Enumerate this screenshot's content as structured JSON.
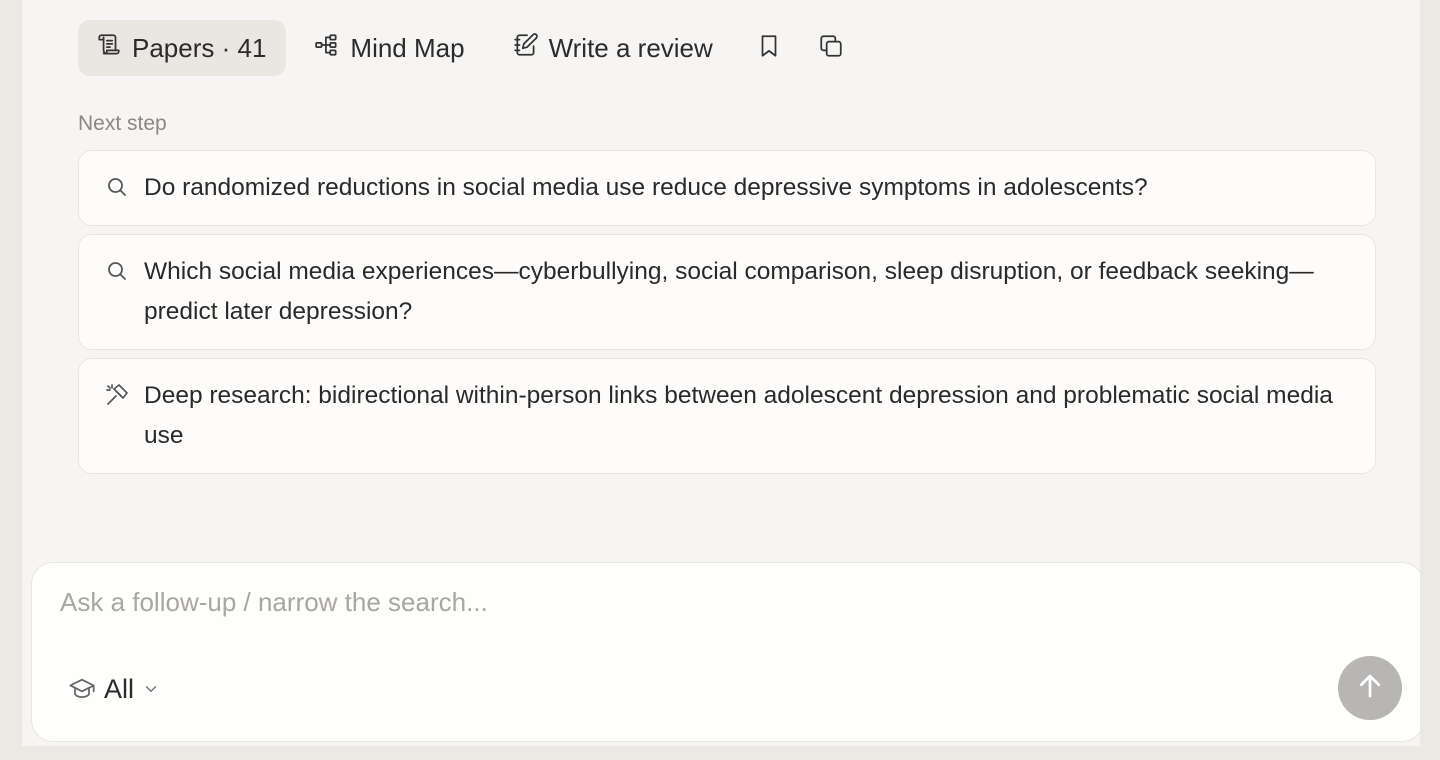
{
  "toolbar": {
    "papers_label": "Papers · 41",
    "mindmap_label": "Mind Map",
    "review_label": "Write a review",
    "icons": [
      "papers-icon",
      "mind-map-icon",
      "write-review-icon",
      "bookmark-icon",
      "copy-icon"
    ]
  },
  "next_step": {
    "label": "Next step",
    "suggestions": [
      {
        "icon": "search-icon",
        "text": "Do randomized reductions in social media use reduce depressive symptoms in adolescents?"
      },
      {
        "icon": "search-icon",
        "text": "Which social media experiences—cyberbullying, social comparison, sleep disruption, or feedback seeking—predict later depression?"
      },
      {
        "icon": "deep-research-icon",
        "text": "Deep research: bidirectional within-person links between adolescent depression and problematic social media use"
      }
    ]
  },
  "composer": {
    "placeholder": "Ask a follow-up / narrow the search...",
    "value": "",
    "scope_label": "All",
    "scope_icon": "graduation-cap-icon",
    "send_icon": "arrow-up-icon"
  },
  "colors": {
    "background": "#f7f5f3",
    "active_tab": "#eae7e3",
    "card": "#fdfcfb",
    "send_button": "#b8b6b4",
    "muted_text": "#8a8784"
  }
}
